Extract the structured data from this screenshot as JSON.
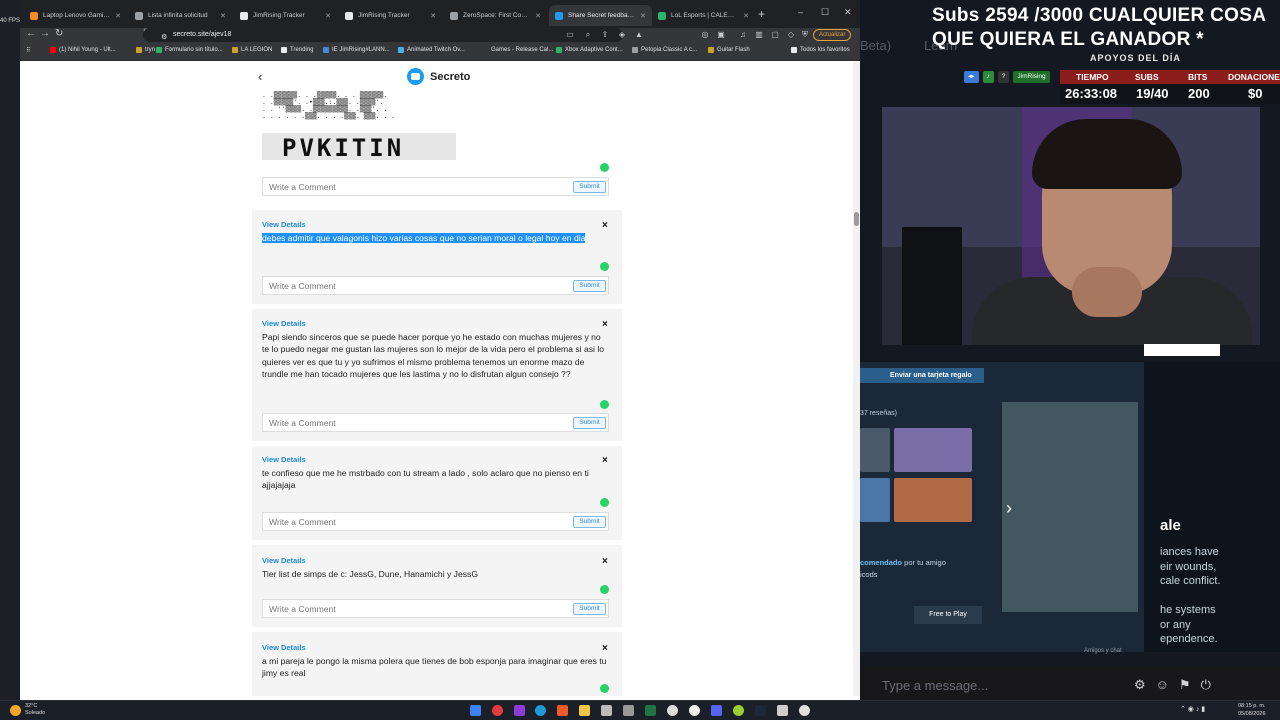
{
  "browser": {
    "tabs": [
      {
        "title": "Laptop Lenovo Gaming Legion",
        "color": "#f28b22",
        "active": false
      },
      {
        "title": "Lista infinita solicitud",
        "color": "#9aa0a6",
        "active": false
      },
      {
        "title": "JimRising Tracker",
        "color": "#e8eaed",
        "active": false
      },
      {
        "title": "JimRising Tracker",
        "color": "#e8eaed",
        "active": false
      },
      {
        "title": "ZeroSpace: First Contact Invit",
        "color": "#9aa0a6",
        "active": false
      },
      {
        "title": "Share Secret feedback at",
        "color": "#1d9bf0",
        "active": true
      },
      {
        "title": "LoL Esports | CALENDARIO",
        "color": "#2fb36b",
        "active": false
      }
    ],
    "new_tab": "+",
    "window_controls": [
      "–",
      "☐",
      "✕"
    ],
    "url": "secreto.site/ajev18",
    "update_label": "Actualizar",
    "bookmarks": [
      {
        "label": "(1) Nihil Young - Ult...",
        "color": "#ff0000"
      },
      {
        "label": "tryn",
        "color": "#c9a227"
      },
      {
        "label": "Formulario sin título...",
        "color": "#2fb36b"
      },
      {
        "label": "LA LEGION",
        "color": "#c9a227"
      },
      {
        "label": "Trending",
        "color": "#e8eaed"
      },
      {
        "label": "IE JimRising#LANN...",
        "color": "#4a8ad4"
      },
      {
        "label": "Animated Twitch Ov...",
        "color": "#4ab0e6"
      },
      {
        "label": "Games - Release Cal...",
        "color": "#35363a"
      },
      {
        "label": "Xbox Adaptive Cont...",
        "color": "#2fb36b"
      },
      {
        "label": "Petopia Classic A c...",
        "color": "#9aa0a6"
      },
      {
        "label": "Guitar Flash",
        "color": "#c9a227"
      },
      {
        "label": "Todos los favoritos",
        "color": "#e8eaed"
      }
    ]
  },
  "page": {
    "title": "Secreto",
    "back": "‹",
    "ascii_art": ". .▒▒▒▒▒▒. . .▒▒▒▒▒. . . ▒▒▒▒▒▒.\n. .▒▒▒▒▒'. .•▒▒▒.:.▒▒▒. .▒▒▒▒'.\n. . ''▒▒▒▒. .▒▒▒▒▒▒▒▒▒. .▒▒▒'. .\n. . . . . .▒▒▒. . . .▒▒▒. ▒▒▒. . .",
    "ascii_banner": "PVKITIN",
    "comment_placeholder": "Write a Comment",
    "submit_label": "Submit",
    "view_details_label": "View Details",
    "close_label": "×",
    "posts": [
      {
        "text": "debes admitir que valagonis hizo varias cosas que no serian moral o legal hoy en dia",
        "selected": true
      },
      {
        "text": "Papi siendo sinceros que se puede hacer porque yo he estado con muchas mujeres y no te lo puedo negar me gustan las mujeres son lo mejor de la vida pero el problema si asi lo quieres ver es que tu y yo sufrimos el mismo problema tenemos un enorme mazo de trundle me han tocado mujeres que les lastima y no lo disfrutan algun consejo ??",
        "selected": false
      },
      {
        "text": "te confieso que me he mstrbado con tu stream a lado , solo aclaro que no pienso en ti ajjajajaja",
        "selected": false
      },
      {
        "text": "Tier list de simps de c: JessG, Dune, Hanamichi y JessG",
        "selected": false
      },
      {
        "text": "a mi pareja le pongo la misma polera que tienes de bob esponja para imaginar que eres tu jimy es real",
        "selected": false
      }
    ]
  },
  "overlay": {
    "goal_text": "Subs 2594 /3000 CUALQUIER COSA QUE QUIERA EL GANADOR *",
    "bg_beta": "Beta)",
    "bg_learn": "Learn",
    "apoyos": "APOYOS DEL DÍA",
    "chat_user": "JimRising",
    "stats": [
      {
        "label": "TIEMPO",
        "value": "26:33:08"
      },
      {
        "label": "SUBS",
        "value": "19/40"
      },
      {
        "label": "BITS",
        "value": "200"
      },
      {
        "label": "DONACIONES",
        "value": "$0"
      }
    ],
    "steam": {
      "gift_label": "Enviar una tarjeta regalo",
      "reviews": "37 reseñas)",
      "recomendado_strong": "comendado",
      "recomendado_rest": " por tu amigo",
      "recomendado_line2": "icods",
      "free_play": "Free to Play",
      "title_fragment": "ale",
      "desc_fragment": "iances have\neir wounds,\ncale conflict.\n\nhe systems\nor any\nependence.",
      "friends_chat": "Amigos y chat"
    },
    "chat_placeholder": "Type a message..."
  },
  "taskbar": {
    "weather_temp": "32°C",
    "weather_desc": "Soleado",
    "time": "08:15 p. m.",
    "date": "05/08/2026",
    "fps": "40 FPS"
  }
}
